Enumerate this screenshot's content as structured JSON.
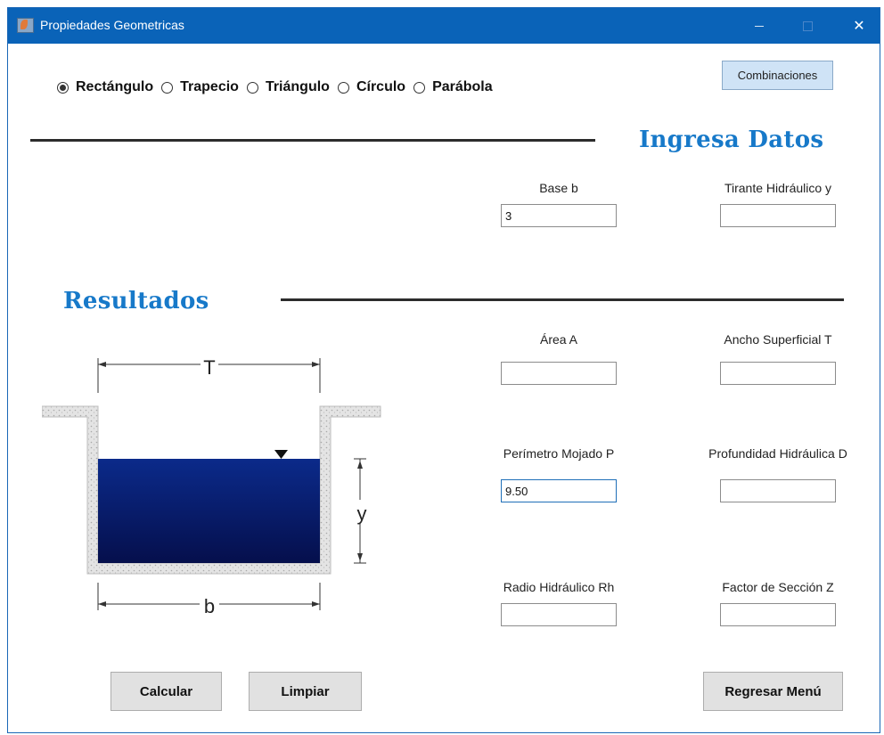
{
  "window": {
    "title": "Propiedades Geometricas",
    "controls": {
      "minimize": "—",
      "maximize": "□",
      "close": "✕"
    }
  },
  "shapes": [
    {
      "label": "Rectángulo",
      "checked": true
    },
    {
      "label": "Trapecio",
      "checked": false
    },
    {
      "label": "Triángulo",
      "checked": false
    },
    {
      "label": "Círculo",
      "checked": false
    },
    {
      "label": "Parábola",
      "checked": false
    }
  ],
  "combinaciones_label": "Combinaciones",
  "input_section": {
    "title": "Ingresa Datos",
    "base": {
      "label": "Base b",
      "value": "3"
    },
    "tirante": {
      "label": "Tirante Hidráulico y",
      "value": ""
    }
  },
  "results_section": {
    "title": "Resultados",
    "area": {
      "label": "Área A",
      "value": ""
    },
    "ancho": {
      "label": "Ancho Superficial T",
      "value": ""
    },
    "perimetro": {
      "label": "Perímetro Mojado P",
      "value": "9.50"
    },
    "profundidad": {
      "label": "Profundidad Hidráulica D",
      "value": ""
    },
    "radio": {
      "label": "Radio Hidráulico Rh",
      "value": ""
    },
    "factor": {
      "label": "Factor de Sección Z",
      "value": ""
    }
  },
  "diagram": {
    "label_T": "T",
    "label_y": "y",
    "label_b": "b",
    "water_color": "#0a1a66"
  },
  "buttons": {
    "calcular": "Calcular",
    "limpiar": "Limpiar",
    "regresar": "Regresar Menú"
  },
  "colors": {
    "titlebar": "#0a63b8",
    "heading": "#1779c9",
    "combinaciones_bg": "#cfe3f6"
  }
}
